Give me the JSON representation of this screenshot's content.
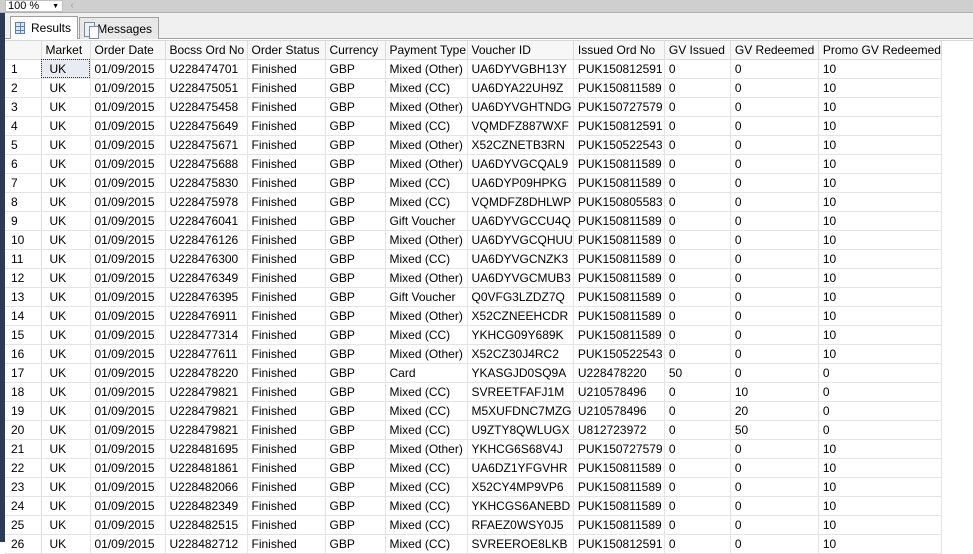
{
  "toolbar": {
    "zoom_level": "100 %"
  },
  "tabs": [
    {
      "label": "Results",
      "icon": "grid-icon",
      "active": true
    },
    {
      "label": "Messages",
      "icon": "messages-icon",
      "active": false
    }
  ],
  "grid": {
    "columns": [
      "Market",
      "Order Date",
      "Bocss Ord No",
      "Order Status",
      "Currency",
      "Payment Type",
      "Voucher ID",
      "Issued Ord No",
      "GV Issued",
      "GV Redeemed",
      "Promo GV Redeemed"
    ],
    "rows": [
      [
        "1",
        "UK",
        "01/09/2015",
        "U228474701",
        "Finished",
        "GBP",
        "Mixed (Other)",
        "UA6DYVGBH13Y",
        "PUK150812591",
        "0",
        "0",
        "10"
      ],
      [
        "2",
        "UK",
        "01/09/2015",
        "U228475051",
        "Finished",
        "GBP",
        "Mixed (CC)",
        "UA6DYA22UH9Z",
        "PUK150811589",
        "0",
        "0",
        "10"
      ],
      [
        "3",
        "UK",
        "01/09/2015",
        "U228475458",
        "Finished",
        "GBP",
        "Mixed (Other)",
        "UA6DYVGHTNDG",
        "PUK150727579",
        "0",
        "0",
        "10"
      ],
      [
        "4",
        "UK",
        "01/09/2015",
        "U228475649",
        "Finished",
        "GBP",
        "Mixed (CC)",
        "VQMDFZ887WXF",
        "PUK150812591",
        "0",
        "0",
        "10"
      ],
      [
        "5",
        "UK",
        "01/09/2015",
        "U228475671",
        "Finished",
        "GBP",
        "Mixed (Other)",
        "X52CZNETB3RN",
        "PUK150522543",
        "0",
        "0",
        "10"
      ],
      [
        "6",
        "UK",
        "01/09/2015",
        "U228475688",
        "Finished",
        "GBP",
        "Mixed (Other)",
        "UA6DYVGCQAL9",
        "PUK150811589",
        "0",
        "0",
        "10"
      ],
      [
        "7",
        "UK",
        "01/09/2015",
        "U228475830",
        "Finished",
        "GBP",
        "Mixed (CC)",
        "UA6DYP09HPKG",
        "PUK150811589",
        "0",
        "0",
        "10"
      ],
      [
        "8",
        "UK",
        "01/09/2015",
        "U228475978",
        "Finished",
        "GBP",
        "Mixed (CC)",
        "VQMDFZ8DHLWP",
        "PUK150805583",
        "0",
        "0",
        "10"
      ],
      [
        "9",
        "UK",
        "01/09/2015",
        "U228476041",
        "Finished",
        "GBP",
        "Gift Voucher",
        "UA6DYVGCCU4Q",
        "PUK150811589",
        "0",
        "0",
        "10"
      ],
      [
        "10",
        "UK",
        "01/09/2015",
        "U228476126",
        "Finished",
        "GBP",
        "Mixed (Other)",
        "UA6DYVGCQHUU",
        "PUK150811589",
        "0",
        "0",
        "10"
      ],
      [
        "11",
        "UK",
        "01/09/2015",
        "U228476300",
        "Finished",
        "GBP",
        "Mixed (CC)",
        "UA6DYVGCNZK3",
        "PUK150811589",
        "0",
        "0",
        "10"
      ],
      [
        "12",
        "UK",
        "01/09/2015",
        "U228476349",
        "Finished",
        "GBP",
        "Mixed (Other)",
        "UA6DYVGCMUB3",
        "PUK150811589",
        "0",
        "0",
        "10"
      ],
      [
        "13",
        "UK",
        "01/09/2015",
        "U228476395",
        "Finished",
        "GBP",
        "Gift Voucher",
        "Q0VFG3LZDZ7Q",
        "PUK150811589",
        "0",
        "0",
        "10"
      ],
      [
        "14",
        "UK",
        "01/09/2015",
        "U228476911",
        "Finished",
        "GBP",
        "Mixed (Other)",
        "X52CZNEEHCDR",
        "PUK150811589",
        "0",
        "0",
        "10"
      ],
      [
        "15",
        "UK",
        "01/09/2015",
        "U228477314",
        "Finished",
        "GBP",
        "Mixed (CC)",
        "YKHCG09Y689K",
        "PUK150811589",
        "0",
        "0",
        "10"
      ],
      [
        "16",
        "UK",
        "01/09/2015",
        "U228477611",
        "Finished",
        "GBP",
        "Mixed (Other)",
        "X52CZ30J4RC2",
        "PUK150522543",
        "0",
        "0",
        "10"
      ],
      [
        "17",
        "UK",
        "01/09/2015",
        "U228478220",
        "Finished",
        "GBP",
        "Card",
        "YKASGJD0SQ9A",
        "U228478220",
        "50",
        "0",
        "0"
      ],
      [
        "18",
        "UK",
        "01/09/2015",
        "U228479821",
        "Finished",
        "GBP",
        "Mixed (CC)",
        "SVREETFAFJ1M",
        "U210578496",
        "0",
        "10",
        "0"
      ],
      [
        "19",
        "UK",
        "01/09/2015",
        "U228479821",
        "Finished",
        "GBP",
        "Mixed (CC)",
        "M5XUFDNC7MZG",
        "U210578496",
        "0",
        "20",
        "0"
      ],
      [
        "20",
        "UK",
        "01/09/2015",
        "U228479821",
        "Finished",
        "GBP",
        "Mixed (CC)",
        "U9ZTY8QWLUGX",
        "U812723972",
        "0",
        "50",
        "0"
      ],
      [
        "21",
        "UK",
        "01/09/2015",
        "U228481695",
        "Finished",
        "GBP",
        "Mixed (Other)",
        "YKHCG6S68V4J",
        "PUK150727579",
        "0",
        "0",
        "10"
      ],
      [
        "22",
        "UK",
        "01/09/2015",
        "U228481861",
        "Finished",
        "GBP",
        "Mixed (CC)",
        "UA6DZ1YFGVHR",
        "PUK150811589",
        "0",
        "0",
        "10"
      ],
      [
        "23",
        "UK",
        "01/09/2015",
        "U228482066",
        "Finished",
        "GBP",
        "Mixed (CC)",
        "X52CY4MP9VP6",
        "PUK150811589",
        "0",
        "0",
        "10"
      ],
      [
        "24",
        "UK",
        "01/09/2015",
        "U228482349",
        "Finished",
        "GBP",
        "Mixed (CC)",
        "YKHCGS6ANEBD",
        "PUK150811589",
        "0",
        "0",
        "10"
      ],
      [
        "25",
        "UK",
        "01/09/2015",
        "U228482515",
        "Finished",
        "GBP",
        "Mixed (CC)",
        "RFAEZ0WSY0J5",
        "PUK150811589",
        "0",
        "0",
        "10"
      ],
      [
        "26",
        "UK",
        "01/09/2015",
        "U228482712",
        "Finished",
        "GBP",
        "Mixed (CC)",
        "SVREEROE8LKB",
        "PUK150812591",
        "0",
        "0",
        "10"
      ]
    ]
  }
}
